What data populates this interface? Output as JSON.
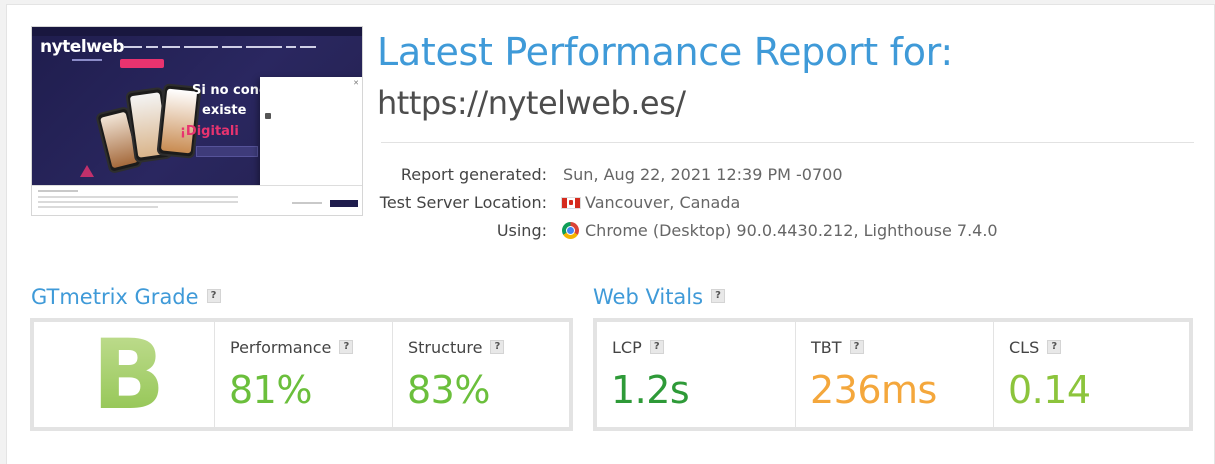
{
  "header": {
    "title": "Latest Performance Report for:",
    "url": "https://nytelweb.es/"
  },
  "thumbnail": {
    "logo": "nytelweb",
    "headline_line1": "Si no conec",
    "headline_line2": "existe",
    "headline_red": "¡Digitali"
  },
  "meta": {
    "generated_label": "Report generated:",
    "generated_value": "Sun, Aug 22, 2021 12:39 PM -0700",
    "location_label": "Test Server Location:",
    "location_value": "Vancouver, Canada",
    "location_icon": "canada-flag-icon",
    "using_label": "Using:",
    "using_value": "Chrome (Desktop) 90.0.4430.212, Lighthouse 7.4.0",
    "using_icon": "chrome-icon"
  },
  "grade": {
    "section_title": "GTmetrix Grade",
    "letter": "B",
    "performance_label": "Performance",
    "performance_value": "81%",
    "structure_label": "Structure",
    "structure_value": "83%"
  },
  "vitals": {
    "section_title": "Web Vitals",
    "lcp_label": "LCP",
    "lcp_value": "1.2s",
    "tbt_label": "TBT",
    "tbt_value": "236ms",
    "cls_label": "CLS",
    "cls_value": "0.14"
  },
  "help_glyph": "?",
  "colors": {
    "accent_blue": "#3f9ad8",
    "green_score": "#6bbf3c",
    "dark_green": "#2e9a38",
    "orange": "#f4a73c",
    "light_green": "#8cc43c"
  }
}
